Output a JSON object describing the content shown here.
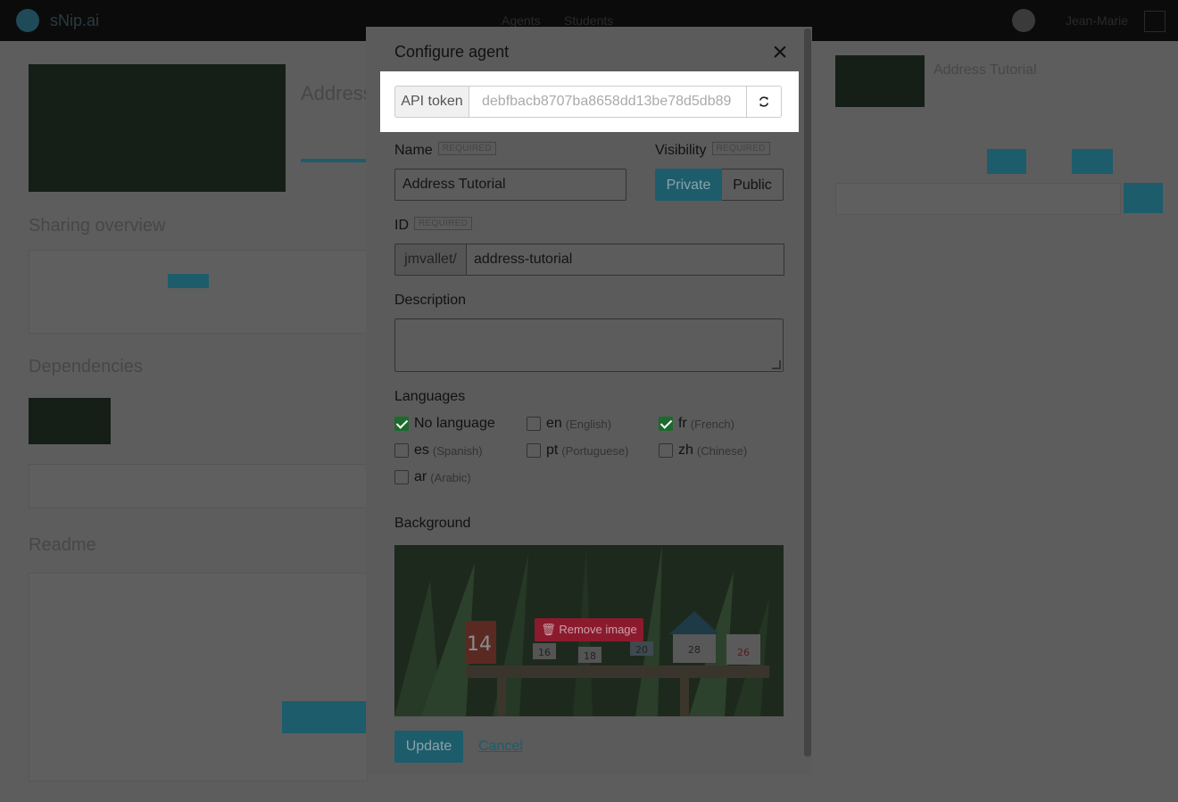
{
  "app": {
    "logo_text": "sNip.ai",
    "nav": [
      "Agents",
      "Students"
    ],
    "user": "Jean-Marie"
  },
  "background_page": {
    "agent_title": "Address",
    "sharing_overview": "Sharing overview",
    "dependencies": "Dependencies",
    "readme": "Readme",
    "side_agent_name": "Address Tutorial"
  },
  "modal": {
    "title": "Configure agent",
    "api_token_label": "API token",
    "api_token_value": "debfbacb8707ba8658dd13be78d5db89",
    "required_tag": "REQUIRED",
    "name_label": "Name",
    "name_value": "Address Tutorial",
    "visibility_label": "Visibility",
    "visibility_options": {
      "private": "Private",
      "public": "Public"
    },
    "visibility_selected": "Private",
    "id_label": "ID",
    "id_prefix": "jmvallet/",
    "id_value": "address-tutorial",
    "description_label": "Description",
    "description_value": "",
    "languages_label": "Languages",
    "languages": [
      {
        "code": "No language",
        "name": "",
        "checked": true
      },
      {
        "code": "en",
        "name": "(English)",
        "checked": false
      },
      {
        "code": "fr",
        "name": "(French)",
        "checked": true
      },
      {
        "code": "es",
        "name": "(Spanish)",
        "checked": false
      },
      {
        "code": "pt",
        "name": "(Portuguese)",
        "checked": false
      },
      {
        "code": "zh",
        "name": "(Chinese)",
        "checked": false
      },
      {
        "code": "ar",
        "name": "(Arabic)",
        "checked": false
      }
    ],
    "background_label": "Background",
    "remove_image_label": "Remove image",
    "mailbox_numbers": [
      "14",
      "16",
      "18",
      "20",
      "28",
      "26"
    ],
    "update_label": "Update",
    "cancel_label": "Cancel"
  },
  "colors": {
    "accent": "#1d5c6b",
    "danger": "#8c1a2d",
    "check": "#1c6b2d"
  }
}
